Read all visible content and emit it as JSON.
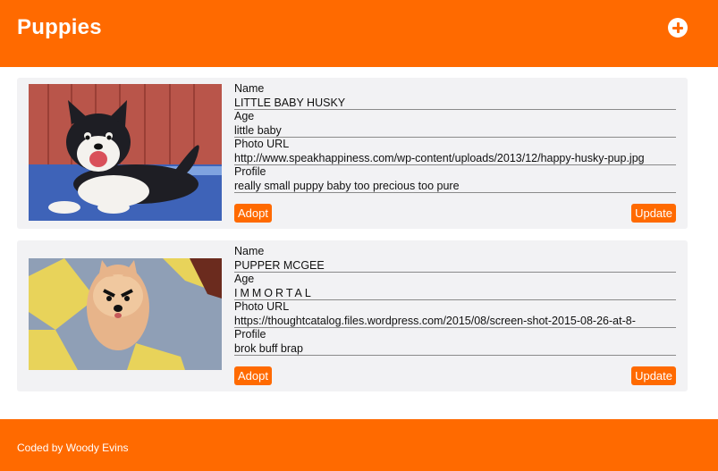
{
  "header": {
    "title": "Puppies",
    "add_icon": "plus-circle-icon"
  },
  "puppies": [
    {
      "labels": {
        "name": "Name",
        "age": "Age",
        "photo_url": "Photo URL",
        "profile": "Profile"
      },
      "name": "LITTLE BABY HUSKY",
      "age": "little baby",
      "photo_url": "http://www.speakhappiness.com/wp-content/uploads/2013/12/happy-husky-pup.jpg",
      "profile": "really small puppy baby too precious too pure",
      "adopt_label": "Adopt",
      "update_label": "Update"
    },
    {
      "labels": {
        "name": "Name",
        "age": "Age",
        "photo_url": "Photo URL",
        "profile": "Profile"
      },
      "name": "PUPPER MCGEE",
      "age": "IMMORTAL",
      "photo_url": "https://thoughtcatalog.files.wordpress.com/2015/08/screen-shot-2015-08-26-at-8-",
      "profile": "brok buff brap",
      "adopt_label": "Adopt",
      "update_label": "Update"
    }
  ],
  "footer": {
    "credit": "Coded by Woody Evins"
  },
  "colors": {
    "accent": "#ff6a00",
    "card_bg": "#f2f2f4"
  }
}
